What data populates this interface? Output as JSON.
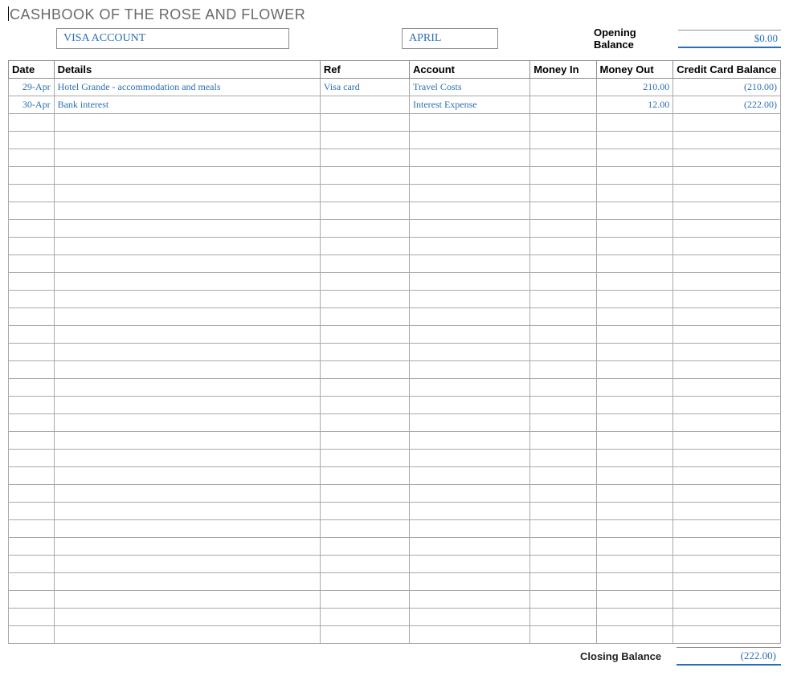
{
  "title": "CASHBOOK OF THE ROSE AND FLOWER",
  "header": {
    "account_name": "VISA ACCOUNT",
    "month": "APRIL",
    "opening_balance_label": "Opening Balance",
    "opening_balance": "$0.00"
  },
  "columns": {
    "date": "Date",
    "details": "Details",
    "ref": "Ref",
    "account": "Account",
    "money_in": "Money In",
    "money_out": "Money Out",
    "balance": "Credit Card Balance"
  },
  "rows": [
    {
      "date": "29-Apr",
      "details": "Hotel Grande - accommodation and meals",
      "ref": "Visa card",
      "account": "Travel Costs",
      "money_in": "",
      "money_out": "210.00",
      "balance": "(210.00)"
    },
    {
      "date": "30-Apr",
      "details": "Bank interest",
      "ref": "",
      "account": "Interest Expense",
      "money_in": "",
      "money_out": "12.00",
      "balance": "(222.00)"
    },
    {
      "date": "",
      "details": "",
      "ref": "",
      "account": "",
      "money_in": "",
      "money_out": "",
      "balance": ""
    },
    {
      "date": "",
      "details": "",
      "ref": "",
      "account": "",
      "money_in": "",
      "money_out": "",
      "balance": ""
    },
    {
      "date": "",
      "details": "",
      "ref": "",
      "account": "",
      "money_in": "",
      "money_out": "",
      "balance": ""
    },
    {
      "date": "",
      "details": "",
      "ref": "",
      "account": "",
      "money_in": "",
      "money_out": "",
      "balance": ""
    },
    {
      "date": "",
      "details": "",
      "ref": "",
      "account": "",
      "money_in": "",
      "money_out": "",
      "balance": ""
    },
    {
      "date": "",
      "details": "",
      "ref": "",
      "account": "",
      "money_in": "",
      "money_out": "",
      "balance": ""
    },
    {
      "date": "",
      "details": "",
      "ref": "",
      "account": "",
      "money_in": "",
      "money_out": "",
      "balance": ""
    },
    {
      "date": "",
      "details": "",
      "ref": "",
      "account": "",
      "money_in": "",
      "money_out": "",
      "balance": ""
    },
    {
      "date": "",
      "details": "",
      "ref": "",
      "account": "",
      "money_in": "",
      "money_out": "",
      "balance": ""
    },
    {
      "date": "",
      "details": "",
      "ref": "",
      "account": "",
      "money_in": "",
      "money_out": "",
      "balance": ""
    },
    {
      "date": "",
      "details": "",
      "ref": "",
      "account": "",
      "money_in": "",
      "money_out": "",
      "balance": ""
    },
    {
      "date": "",
      "details": "",
      "ref": "",
      "account": "",
      "money_in": "",
      "money_out": "",
      "balance": ""
    },
    {
      "date": "",
      "details": "",
      "ref": "",
      "account": "",
      "money_in": "",
      "money_out": "",
      "balance": ""
    },
    {
      "date": "",
      "details": "",
      "ref": "",
      "account": "",
      "money_in": "",
      "money_out": "",
      "balance": ""
    },
    {
      "date": "",
      "details": "",
      "ref": "",
      "account": "",
      "money_in": "",
      "money_out": "",
      "balance": ""
    },
    {
      "date": "",
      "details": "",
      "ref": "",
      "account": "",
      "money_in": "",
      "money_out": "",
      "balance": ""
    },
    {
      "date": "",
      "details": "",
      "ref": "",
      "account": "",
      "money_in": "",
      "money_out": "",
      "balance": ""
    },
    {
      "date": "",
      "details": "",
      "ref": "",
      "account": "",
      "money_in": "",
      "money_out": "",
      "balance": ""
    },
    {
      "date": "",
      "details": "",
      "ref": "",
      "account": "",
      "money_in": "",
      "money_out": "",
      "balance": ""
    },
    {
      "date": "",
      "details": "",
      "ref": "",
      "account": "",
      "money_in": "",
      "money_out": "",
      "balance": ""
    },
    {
      "date": "",
      "details": "",
      "ref": "",
      "account": "",
      "money_in": "",
      "money_out": "",
      "balance": ""
    },
    {
      "date": "",
      "details": "",
      "ref": "",
      "account": "",
      "money_in": "",
      "money_out": "",
      "balance": ""
    },
    {
      "date": "",
      "details": "",
      "ref": "",
      "account": "",
      "money_in": "",
      "money_out": "",
      "balance": ""
    },
    {
      "date": "",
      "details": "",
      "ref": "",
      "account": "",
      "money_in": "",
      "money_out": "",
      "balance": ""
    },
    {
      "date": "",
      "details": "",
      "ref": "",
      "account": "",
      "money_in": "",
      "money_out": "",
      "balance": ""
    },
    {
      "date": "",
      "details": "",
      "ref": "",
      "account": "",
      "money_in": "",
      "money_out": "",
      "balance": ""
    },
    {
      "date": "",
      "details": "",
      "ref": "",
      "account": "",
      "money_in": "",
      "money_out": "",
      "balance": ""
    },
    {
      "date": "",
      "details": "",
      "ref": "",
      "account": "",
      "money_in": "",
      "money_out": "",
      "balance": ""
    },
    {
      "date": "",
      "details": "",
      "ref": "",
      "account": "",
      "money_in": "",
      "money_out": "",
      "balance": ""
    },
    {
      "date": "",
      "details": "",
      "ref": "",
      "account": "",
      "money_in": "",
      "money_out": "",
      "balance": ""
    }
  ],
  "footer": {
    "closing_balance_label": "Closing Balance",
    "closing_balance": "(222.00)"
  }
}
